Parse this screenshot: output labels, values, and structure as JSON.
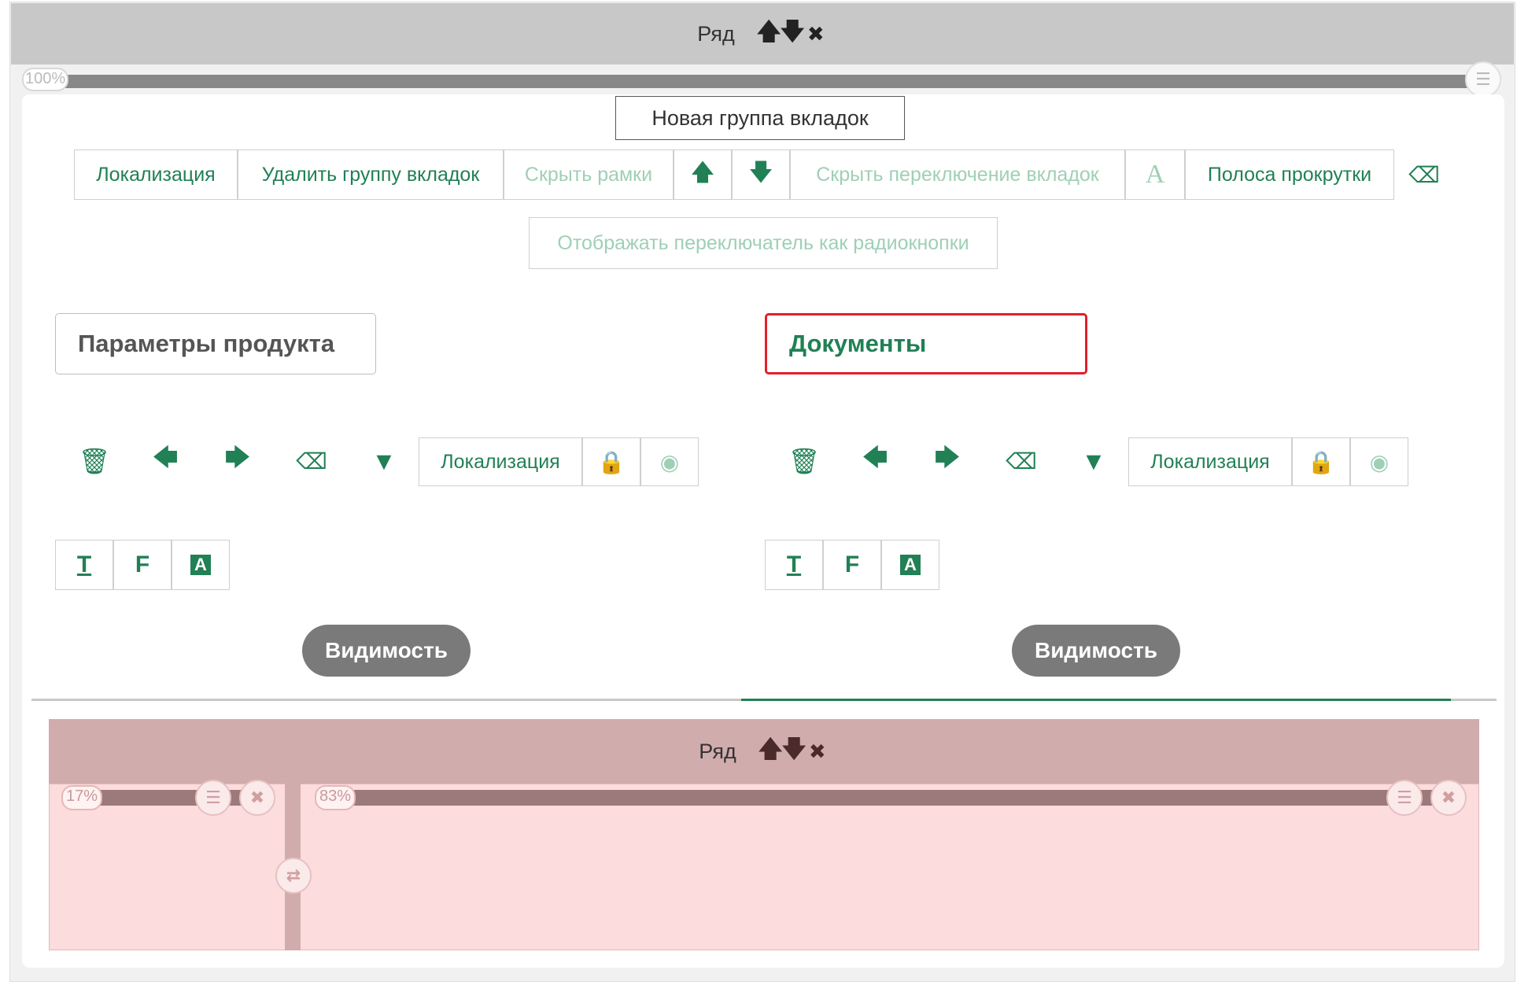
{
  "row_header": {
    "label": "Ряд",
    "up": "🡅",
    "down": "🡇",
    "close": "✖"
  },
  "tab_group": {
    "percent": "100%",
    "new_group_label": "Новая группа вкладок"
  },
  "toolbar": {
    "localization": "Локализация",
    "delete_group": "Удалить группу вкладок",
    "hide_frames": "Скрыть рамки",
    "hide_switch": "Скрыть переключение вкладок",
    "font_glyph": "A",
    "scrollbar": "Полоса прокрутки",
    "radio_switch": "Отображать переключатель как радиокнопки"
  },
  "tabs": [
    {
      "title": "Параметры продукта",
      "localization": "Локализация",
      "visibility": "Видимость",
      "fmt_t": "T",
      "fmt_f": "F",
      "fmt_a": "A"
    },
    {
      "title": "Документы",
      "localization": "Локализация",
      "visibility": "Видимость",
      "fmt_t": "T",
      "fmt_f": "F",
      "fmt_a": "A"
    }
  ],
  "inner_row": {
    "label": "Ряд",
    "up": "🡅",
    "down": "🡇",
    "close": "✖",
    "col1_percent": "17%",
    "col2_percent": "83%"
  },
  "colors": {
    "accent": "#218055",
    "highlight": "#e0202c",
    "row_gray": "#c8c8c8",
    "row_pink": "#d0acad",
    "body_pink": "#fcdcdd"
  }
}
